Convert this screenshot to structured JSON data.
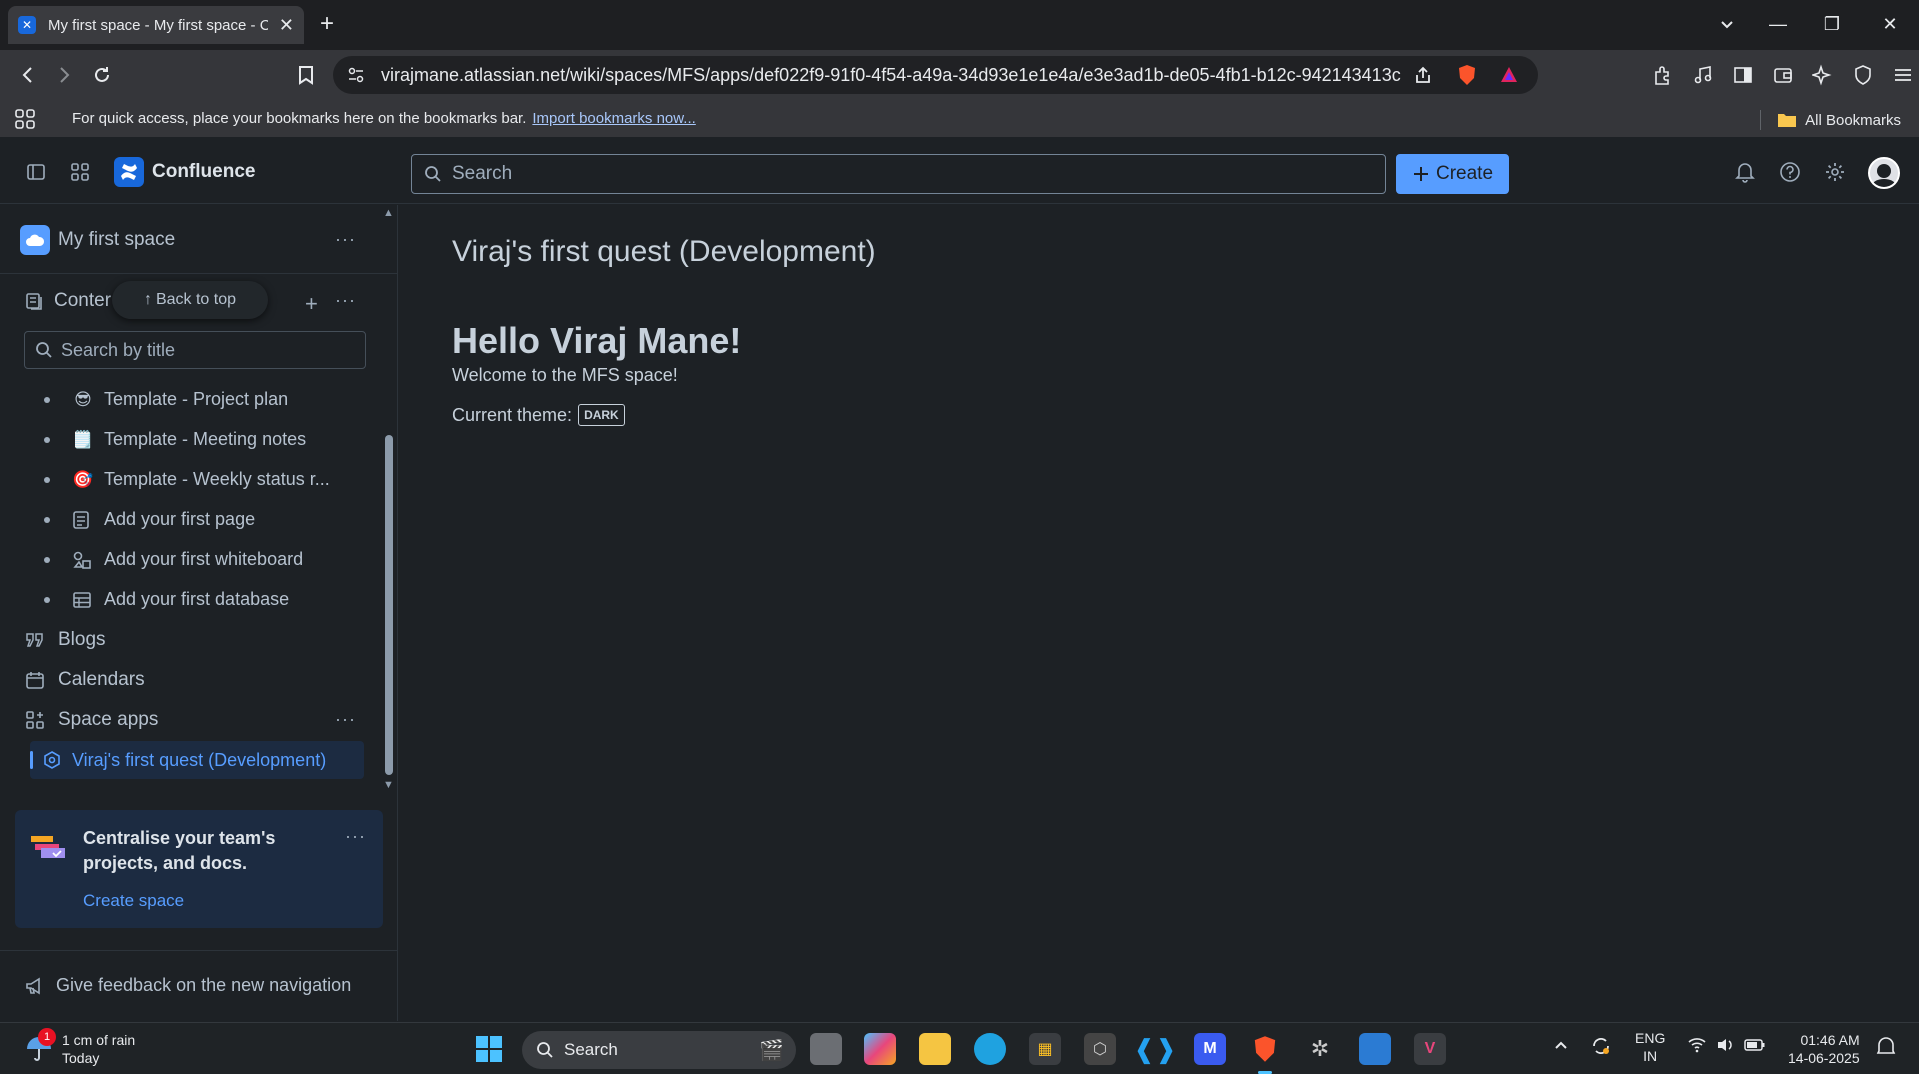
{
  "browser": {
    "tab_title": "My first space - My first space - C",
    "url": "virajmane.atlassian.net/wiki/spaces/MFS/apps/def022f9-91f0-4f54-a49a-34d93e1e1e4a/e3e3ad1b-de05-4fb1-b12c-942143413c5f...",
    "bookmarks_hint": "For quick access, place your bookmarks here on the bookmarks bar.",
    "import_link": "Import bookmarks now...",
    "all_bookmarks": "All Bookmarks"
  },
  "confluence": {
    "product_name": "Confluence",
    "search_placeholder": "Search",
    "create_label": "Create"
  },
  "sidebar": {
    "space_name": "My first space",
    "content_label": "Conter",
    "back_to_top": "Back to top",
    "search_placeholder": "Search by title",
    "tree": [
      {
        "emoji": "😎",
        "label": "Template - Project plan"
      },
      {
        "emoji": "🗒️",
        "label": "Template - Meeting notes"
      },
      {
        "emoji": "🎯",
        "label": "Template - Weekly status r..."
      },
      {
        "icon": "page-icon",
        "label": "Add your first page"
      },
      {
        "icon": "whiteboard-icon",
        "label": "Add your first whiteboard"
      },
      {
        "icon": "database-icon",
        "label": "Add your first database"
      }
    ],
    "nav": {
      "blogs": "Blogs",
      "calendars": "Calendars",
      "space_apps": "Space apps",
      "active_app": "Viraj's first quest (Development)"
    },
    "promo": {
      "text": "Centralise your team's projects, and docs.",
      "link": "Create space"
    },
    "feedback": "Give feedback on the new navigation"
  },
  "main": {
    "title": "Viraj's first quest (Development)",
    "hello": "Hello Viraj Mane!",
    "welcome": "Welcome to the MFS space!",
    "theme_label": "Current theme:",
    "theme_value": "DARK"
  },
  "taskbar": {
    "weather_main": "1 cm of rain",
    "weather_sub": "Today",
    "weather_badge": "1",
    "search": "Search",
    "lang_top": "ENG",
    "lang_bottom": "IN",
    "time": "01:46 AM",
    "date": "14-06-2025"
  },
  "colors": {
    "accent": "#579dff",
    "background": "#1d2125",
    "brand": "#1868db"
  }
}
